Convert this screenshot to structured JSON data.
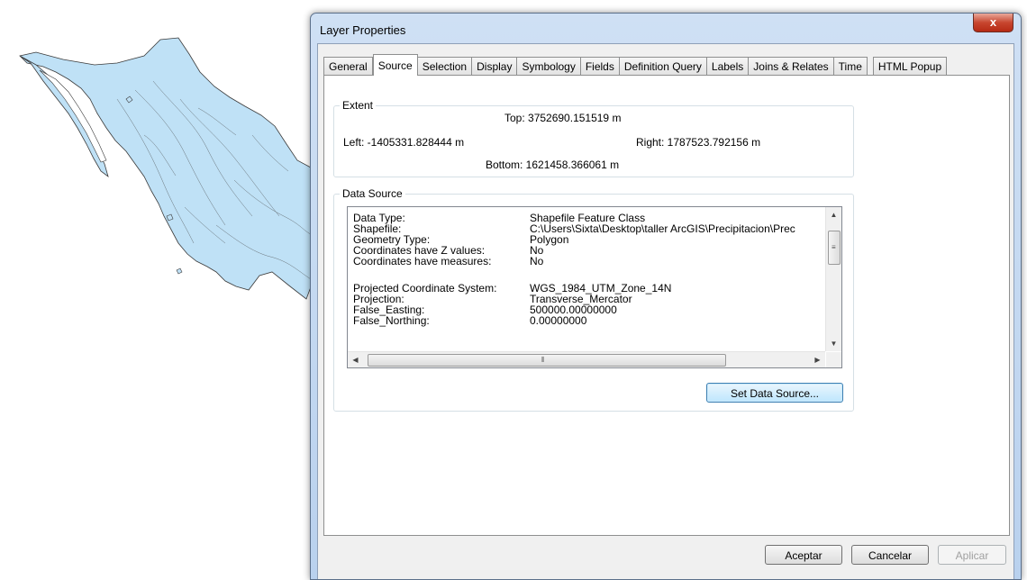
{
  "window": {
    "title": "Layer Properties",
    "close_glyph": "x"
  },
  "tabs": [
    {
      "label": "General",
      "active": false
    },
    {
      "label": "Source",
      "active": true
    },
    {
      "label": "Selection",
      "active": false
    },
    {
      "label": "Display",
      "active": false
    },
    {
      "label": "Symbology",
      "active": false
    },
    {
      "label": "Fields",
      "active": false
    },
    {
      "label": "Definition Query",
      "active": false
    },
    {
      "label": "Labels",
      "active": false
    },
    {
      "label": "Joins & Relates",
      "active": false
    },
    {
      "label": "Time",
      "active": false
    },
    {
      "label": "HTML Popup",
      "active": false
    }
  ],
  "extent": {
    "label": "Extent",
    "top": "Top:  3752690.151519 m",
    "left": "Left: -1405331.828444 m",
    "right": "Right:  1787523.792156 m",
    "bottom": "Bottom:  1621458.366061 m"
  },
  "data_source": {
    "label": "Data Source",
    "rows": [
      {
        "key": "Data Type:",
        "value": "Shapefile Feature Class"
      },
      {
        "key": "Shapefile:",
        "value": "C:\\Users\\Sixta\\Desktop\\taller ArcGIS\\Precipitacion\\Prec"
      },
      {
        "key": "Geometry Type:",
        "value": "Polygon"
      },
      {
        "key": "Coordinates have Z values:",
        "value": "No"
      },
      {
        "key": "Coordinates have measures:",
        "value": "No"
      },
      {
        "key": "",
        "value": ""
      },
      {
        "key": "Projected Coordinate System:",
        "value": "WGS_1984_UTM_Zone_14N"
      },
      {
        "key": "Projection:",
        "value": "Transverse_Mercator"
      },
      {
        "key": "False_Easting:",
        "value": "500000.00000000"
      },
      {
        "key": "False_Northing:",
        "value": "0.00000000"
      }
    ],
    "set_button": "Set Data Source..."
  },
  "buttons": {
    "ok": "Aceptar",
    "cancel": "Cancelar",
    "apply": "Aplicar"
  },
  "colors": {
    "map_fill": "#bfe1f6",
    "map_stroke": "#3a3a3a",
    "accent": "#3c7fb1"
  },
  "icons": {
    "close": "close-icon",
    "scroll_up": "arrow-up-icon",
    "scroll_down": "arrow-down-icon",
    "scroll_left": "arrow-left-icon",
    "scroll_right": "arrow-right-icon"
  }
}
